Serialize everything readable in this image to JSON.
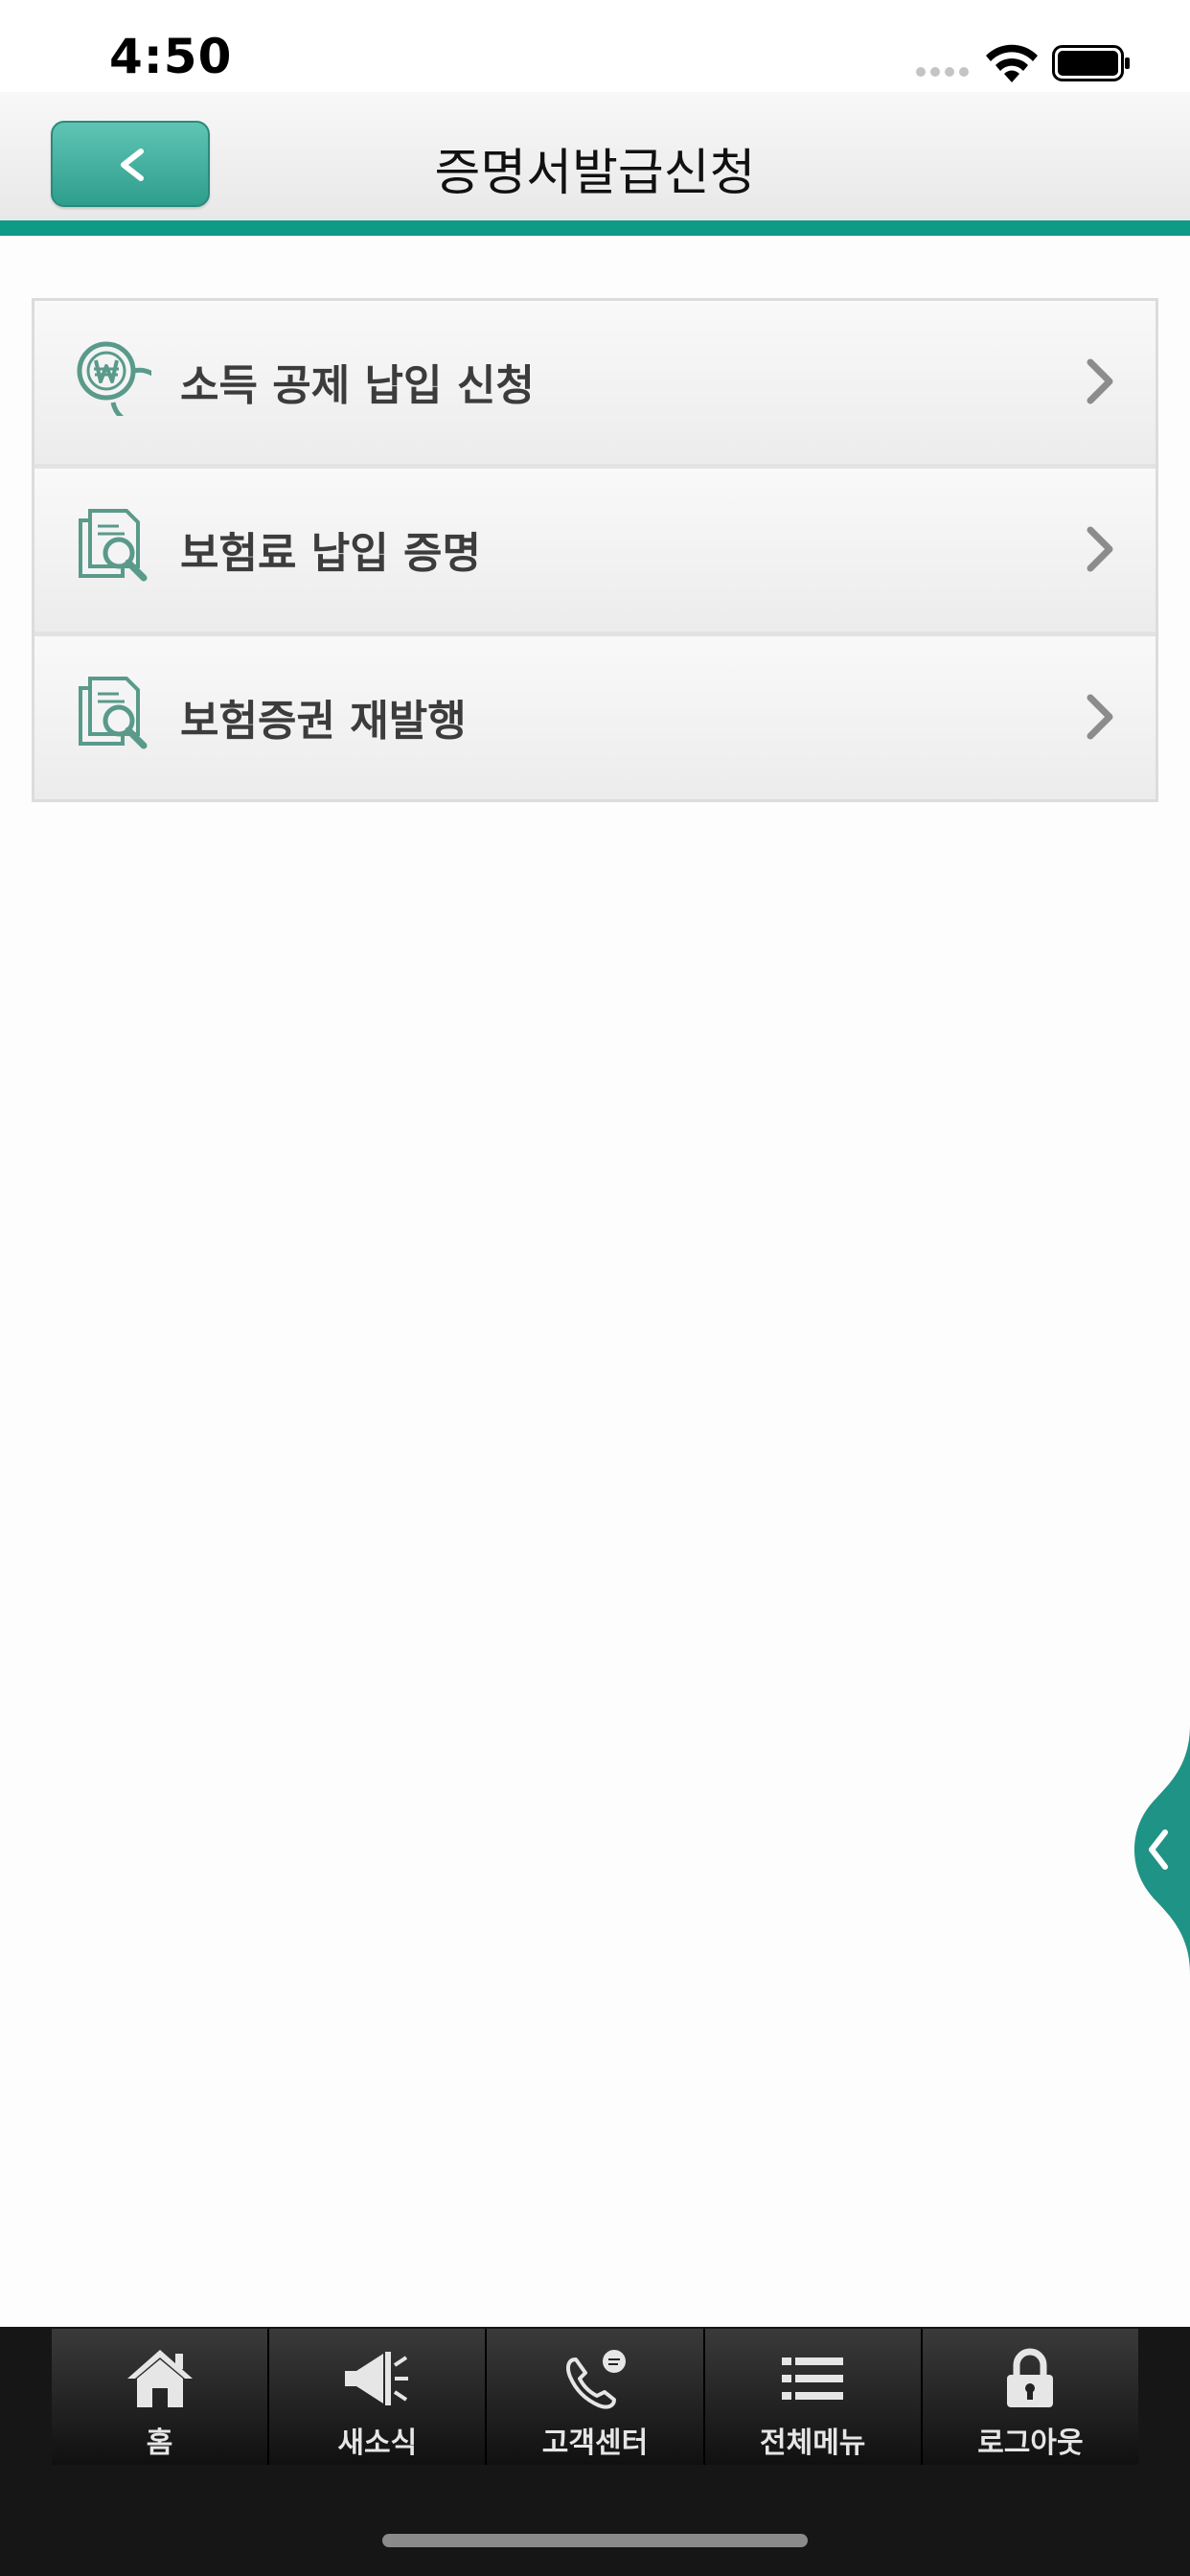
{
  "status_bar": {
    "time": "4:50"
  },
  "header": {
    "title": "증명서발급신청",
    "back_icon": "chevron-left-icon"
  },
  "colors": {
    "accent": "#0e9a86",
    "icon_green": "#5a9a8a"
  },
  "menu": {
    "items": [
      {
        "label": "소득 공제 납입 신청",
        "icon": "won-coin-icon"
      },
      {
        "label": "보험료 납입 증명",
        "icon": "document-search-icon"
      },
      {
        "label": "보험증권 재발행",
        "icon": "document-search-icon"
      }
    ]
  },
  "tabbar": {
    "tabs": [
      {
        "label": "홈",
        "icon": "home-icon"
      },
      {
        "label": "새소식",
        "icon": "megaphone-icon"
      },
      {
        "label": "고객센터",
        "icon": "phone-chat-icon"
      },
      {
        "label": "전체메뉴",
        "icon": "list-icon"
      },
      {
        "label": "로그아웃",
        "icon": "lock-icon"
      }
    ]
  }
}
